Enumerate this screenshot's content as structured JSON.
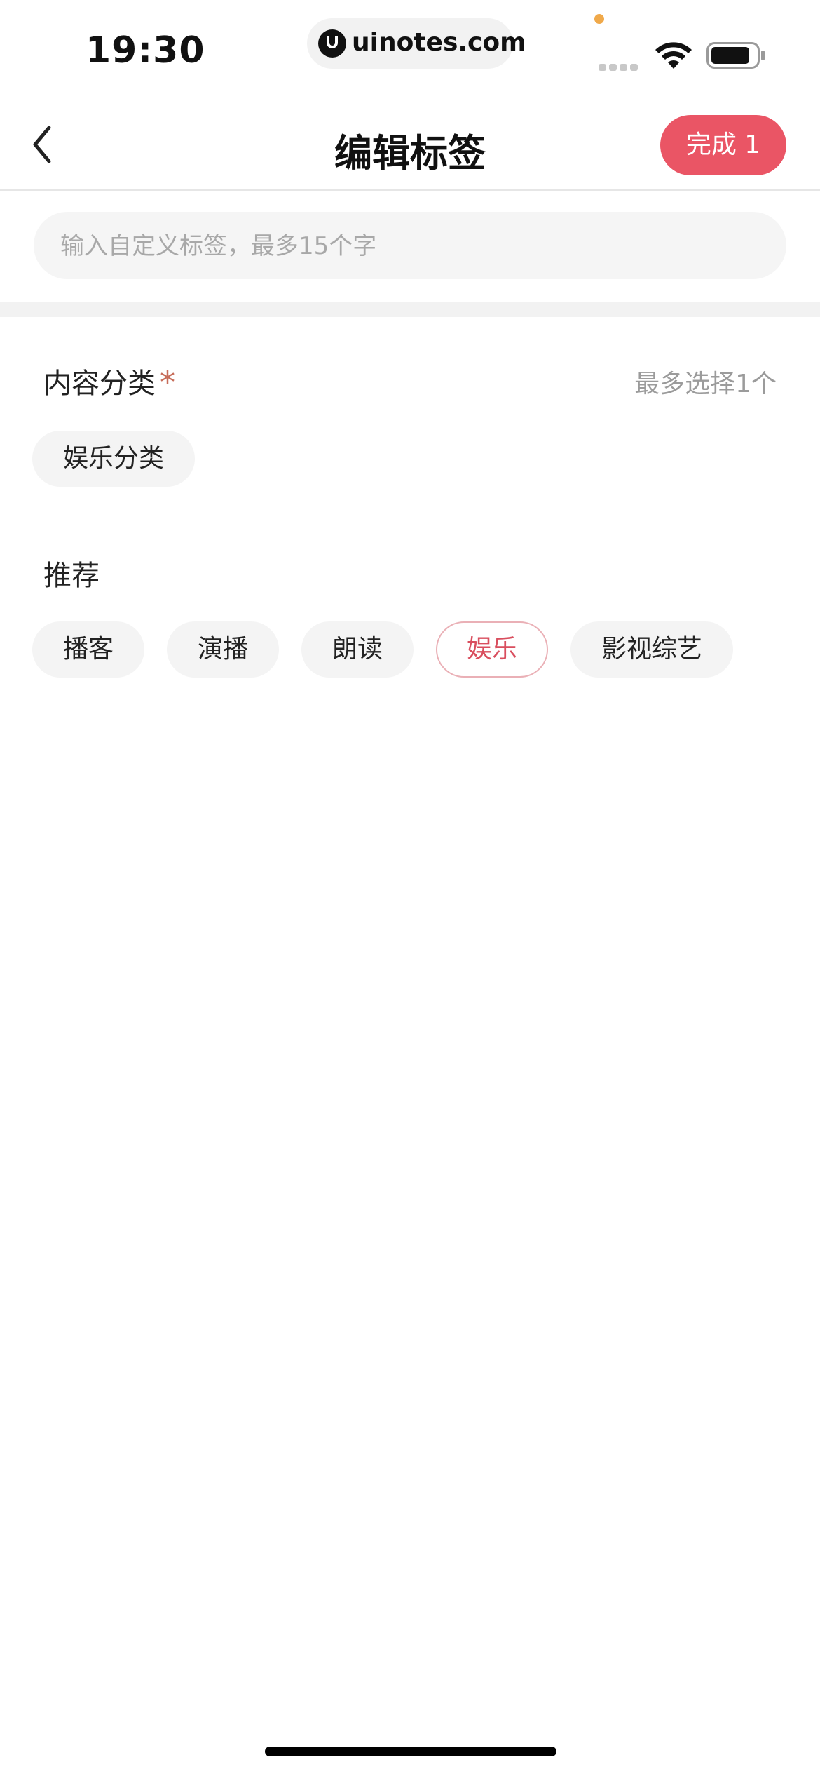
{
  "status_bar": {
    "time": "19:30",
    "url": "uinotes.com",
    "notification_dot_color": "#f0a94a",
    "wifi_icon": "wifi-icon",
    "battery_icon": "battery-icon"
  },
  "nav": {
    "back_icon": "chevron-left-icon",
    "title": "编辑标签",
    "done_label": "完成 1",
    "accent_color": "#ea5565"
  },
  "search": {
    "placeholder": "输入自定义标签，最多15个字",
    "value": ""
  },
  "content_category": {
    "label": "内容分类",
    "required_mark": "*",
    "hint": "最多选择1个",
    "tags": [
      {
        "label": "娱乐分类",
        "selected": false
      }
    ]
  },
  "recommended": {
    "label": "推荐",
    "tags": [
      {
        "label": "播客",
        "selected": false
      },
      {
        "label": "演播",
        "selected": false
      },
      {
        "label": "朗读",
        "selected": false
      },
      {
        "label": "娱乐",
        "selected": true
      },
      {
        "label": "影视综艺",
        "selected": false
      }
    ],
    "selected_color": "#d94e5e"
  }
}
